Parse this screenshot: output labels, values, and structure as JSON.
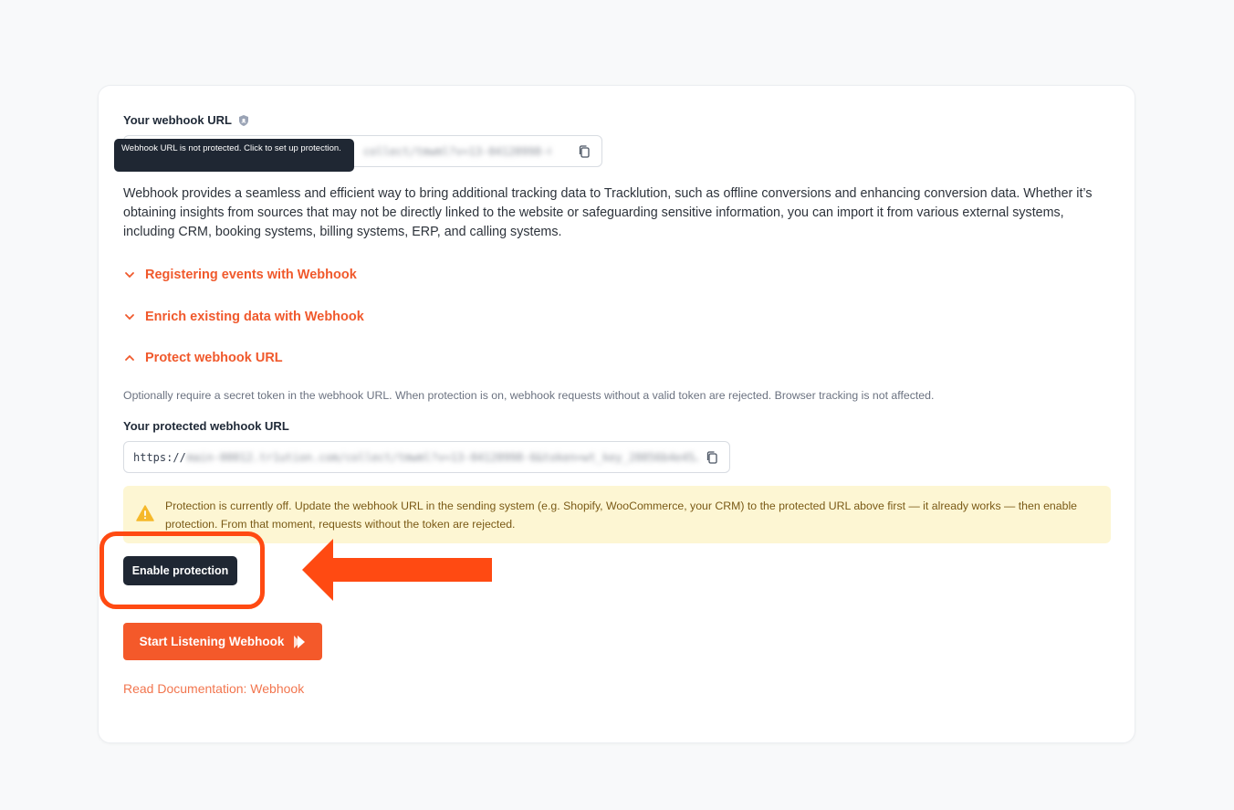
{
  "webhook_url": {
    "label": "Your webhook URL",
    "value_blurred": "collect/tmwml?v=13-04120998-6",
    "tooltip": "Webhook URL is not protected. Click to set up protection."
  },
  "description": "Webhook provides a seamless and efficient way to bring additional tracking data to Tracklution, such as offline conversions and enhancing conversion data. Whether it’s obtaining insights from sources that may not be directly linked to the website or safeguarding sensitive information, you can import it from various external systems, including CRM, booking systems, billing systems, ERP, and calling systems.",
  "accordions": [
    {
      "label": "Registering events with Webhook",
      "expanded": false
    },
    {
      "label": "Enrich existing data with Webhook",
      "expanded": false
    },
    {
      "label": "Protect webhook URL",
      "expanded": true
    }
  ],
  "protect": {
    "hint": "Optionally require a secret token in the webhook URL. When protection is on, webhook requests without a valid token are rejected. Browser tracking is not affected.",
    "label": "Your protected webhook URL",
    "url_prefix": "https://",
    "url_blurred": "main-00012.tr1ution.com/collect/tmwml?v=13-04120998-6&token=wt_key_28856b4e45…",
    "alert": "Protection is currently off. Update the webhook URL in the sending system (e.g. Shopify, WooCommerce, your CRM) to the protected URL above first — it already works — then enable protection. From that moment, requests without the token are rejected.",
    "enable_label": "Enable protection"
  },
  "start_label": "Start Listening Webhook",
  "doc_link": "Read Documentation: Webhook",
  "colors": {
    "accent": "#f0592c",
    "dark_button": "#1f2733",
    "alert_bg": "#fdf6d3",
    "annotation": "#ff4a12"
  }
}
